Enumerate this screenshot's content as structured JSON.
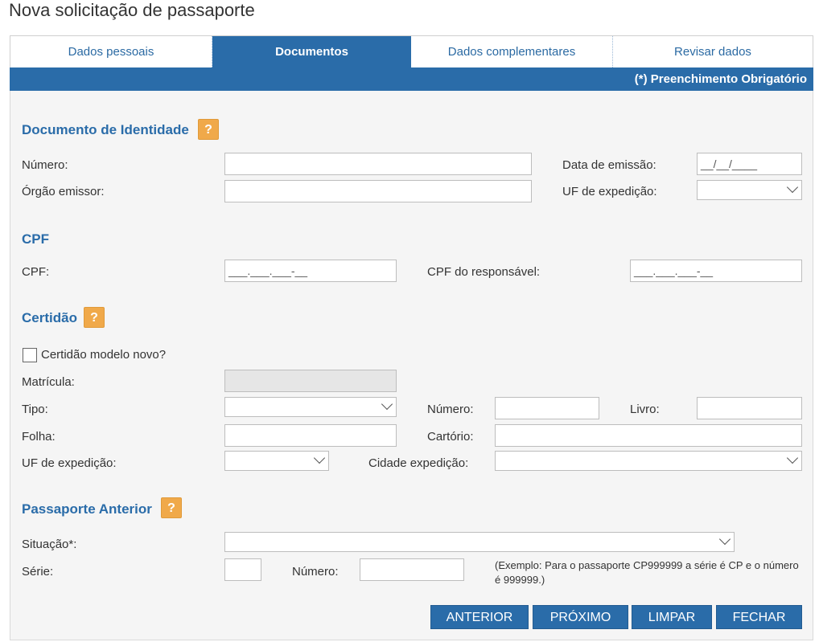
{
  "page": {
    "title": "Nova solicitação de passaporte"
  },
  "tabs": [
    {
      "label": "Dados pessoais"
    },
    {
      "label": "Documentos"
    },
    {
      "label": "Dados complementares"
    },
    {
      "label": "Revisar dados"
    }
  ],
  "active_tab": "Documentos",
  "required_note": "(*) Preenchimento Obrigatório",
  "help_icon_text": "?",
  "identidade": {
    "title": "Documento de Identidade",
    "numero_label": "Número:",
    "numero_value": "",
    "orgao_label": "Órgão emissor:",
    "orgao_value": "",
    "data_label": "Data de emissão:",
    "data_value": "__/__/____",
    "uf_label": "UF de expedição:",
    "uf_value": ""
  },
  "cpf": {
    "title": "CPF",
    "cpf_label": "CPF:",
    "cpf_value": "___.___.___-__",
    "resp_label": "CPF do responsável:",
    "resp_value": "___.___.___-__"
  },
  "certidao": {
    "title": "Certidão",
    "modelo_label": "Certidão modelo novo?",
    "modelo_checked": false,
    "matricula_label": "Matrícula:",
    "matricula_value": "",
    "tipo_label": "Tipo:",
    "tipo_value": "",
    "numero_label": "Número:",
    "numero_value": "",
    "livro_label": "Livro:",
    "livro_value": "",
    "folha_label": "Folha:",
    "folha_value": "",
    "cartorio_label": "Cartório:",
    "cartorio_value": "",
    "uf_label": "UF de expedição:",
    "uf_value": "",
    "cidade_label": "Cidade expedição:",
    "cidade_value": ""
  },
  "passaporte": {
    "title": "Passaporte Anterior",
    "situacao_label": "Situação*:",
    "situacao_value": "",
    "serie_label": "Série:",
    "serie_value": "",
    "numero_label": "Número:",
    "numero_value": "",
    "example": "(Exemplo: Para o passaporte CP999999 a série é CP e o número é 999999.)"
  },
  "buttons": {
    "anterior": "ANTERIOR",
    "proximo": "PRÓXIMO",
    "limpar": "LIMPAR",
    "fechar": "FECHAR"
  },
  "colors": {
    "primary": "#2a6ca9",
    "help": "#f0a94a",
    "panel_bg": "#f5f5f5"
  }
}
